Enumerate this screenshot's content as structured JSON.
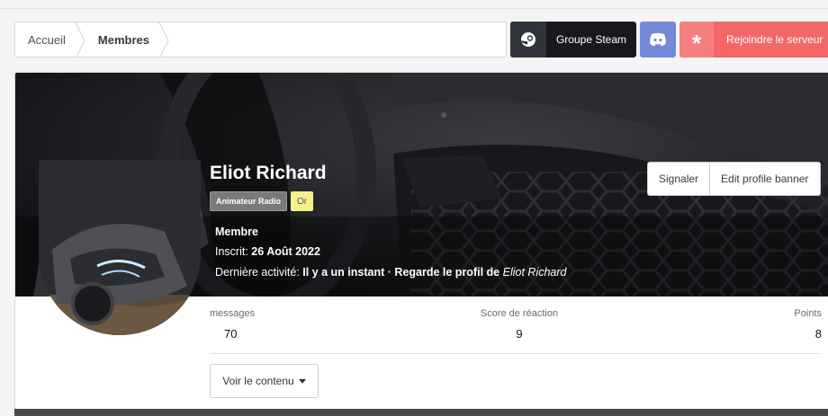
{
  "breadcrumb": {
    "items": [
      "Accueil",
      "Membres"
    ]
  },
  "header_buttons": {
    "steam_label": "Groupe Steam",
    "join_label": "Rejoindre le serveur"
  },
  "profile": {
    "username": "Eliot Richard",
    "badges": [
      "Animateur Radio",
      "Or"
    ],
    "role": "Membre",
    "joined_label": "Inscrit:",
    "joined_date": "26 Août 2022",
    "last_activity_label": "Dernière activité:",
    "last_activity_value": "Il y a un instant",
    "separator": "·",
    "activity_text": "Regarde le profil de",
    "activity_target": "Eliot Richard"
  },
  "actions": {
    "report": "Signaler",
    "edit_banner": "Edit profile banner"
  },
  "stats": [
    {
      "label": "messages",
      "value": "70"
    },
    {
      "label": "Score de réaction",
      "value": "9"
    },
    {
      "label": "Points",
      "value": "8"
    }
  ],
  "content_dropdown": {
    "label": "Voir le contenu"
  },
  "colors": {
    "steam_bg": "#17191e",
    "discord": "#7289da",
    "join": "#f26767",
    "badge_or": "#f5f08c"
  },
  "icons": {
    "steam": "steam-icon",
    "discord": "discord-icon",
    "join": "asterisk-icon"
  }
}
